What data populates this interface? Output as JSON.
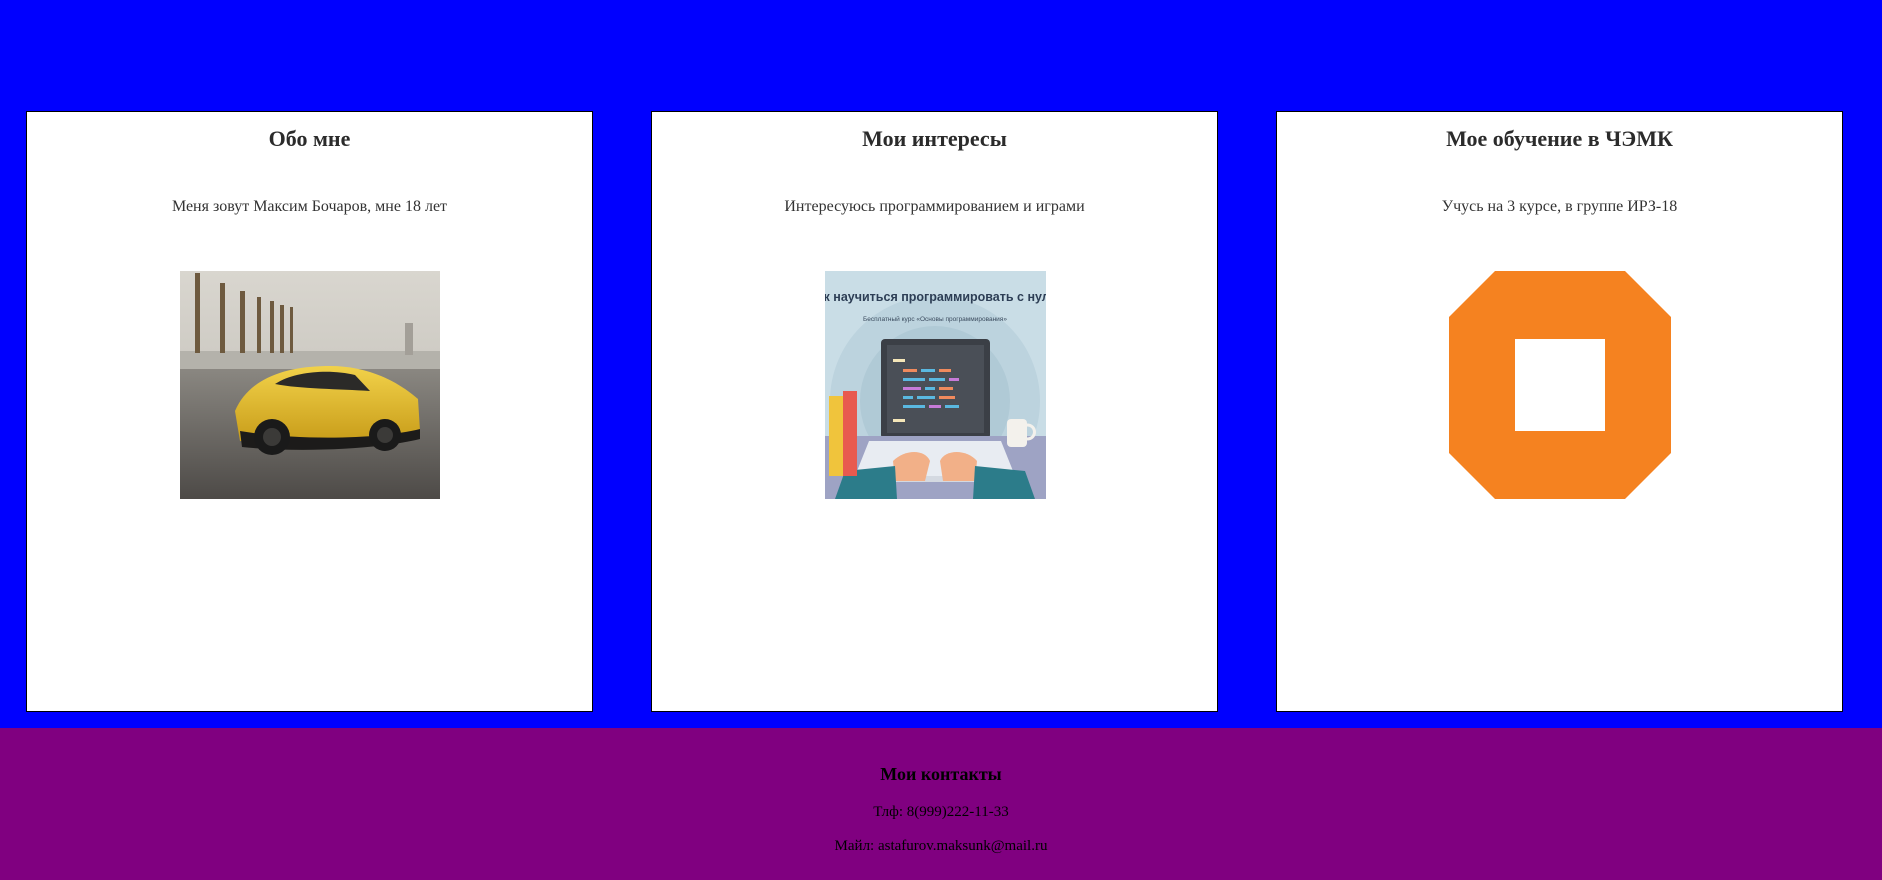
{
  "cards": [
    {
      "title": "Обо мне",
      "text": "Меня зовут Максим Бочаров, мне 18 лет",
      "image": "yellow-sports-car-photo"
    },
    {
      "title": "Мои интересы",
      "text": "Интересуюсь программированием и играми",
      "image": "programming-course-illustration",
      "image_title": "Как научиться программировать с нуля!",
      "image_subtitle": "Бесплатный курс «Основы программирования»"
    },
    {
      "title": "Мое обучение в ЧЭМК",
      "text": "Учусь на 3 курсе, в группе ИРЗ-18",
      "image": "orange-octagon-logo"
    }
  ],
  "footer": {
    "title": "Мои контакты",
    "phone": "Тлф: 8(999)222-11-33",
    "email": "Майл: astafurov.maksunk@mail.ru"
  },
  "colors": {
    "background": "#0000ff",
    "card": "#ffffff",
    "footer": "#800080",
    "logo": "#f58220"
  }
}
